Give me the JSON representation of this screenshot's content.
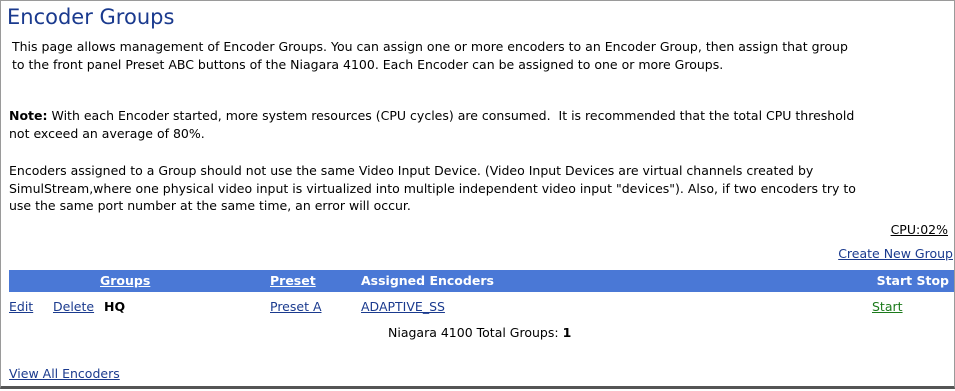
{
  "page": {
    "title": "Encoder Groups",
    "intro": [
      "This page allows management of Encoder Groups. You can assign one or more encoders to an Encoder Group, then assign that group",
      "to the front panel Preset ABC buttons of the Niagara 4100.  Each Encoder can be assigned to one or more Groups."
    ],
    "note_label": "Note:",
    "note": [
      " With each Encoder started, more system resources (CPU cycles) are consumed.  It is recommended that the total CPU threshold",
      "not exceed an average of 80%."
    ],
    "info": [
      "Encoders assigned to a Group should not use the same Video Input Device. (Video Input Devices are virtual channels created by",
      "SimulStream,where one physical video input is virtualized into multiple independent video input \"devices\"). Also, if two encoders try to",
      "use the same port number at the same time, an error will occur."
    ],
    "cpu": "CPU:02%",
    "create_new_group": "Create New Group"
  },
  "table": {
    "headers": {
      "groups": "Groups",
      "preset": "Preset",
      "assigned": "Assigned Encoders",
      "start_stop": "Start Stop"
    },
    "rows": [
      {
        "edit": "Edit",
        "delete": "Delete",
        "group": "HQ",
        "preset": "Preset A",
        "encoders": "ADAPTIVE_SS",
        "action": "Start"
      }
    ]
  },
  "footer": {
    "total_label": "Niagara 4100 Total Groups: ",
    "total_value": "1",
    "view_all": "View All Encoders"
  },
  "colors": {
    "title": "#1a3a8e",
    "header_bg": "#4a78d6",
    "start_link": "#1b7a1b"
  }
}
